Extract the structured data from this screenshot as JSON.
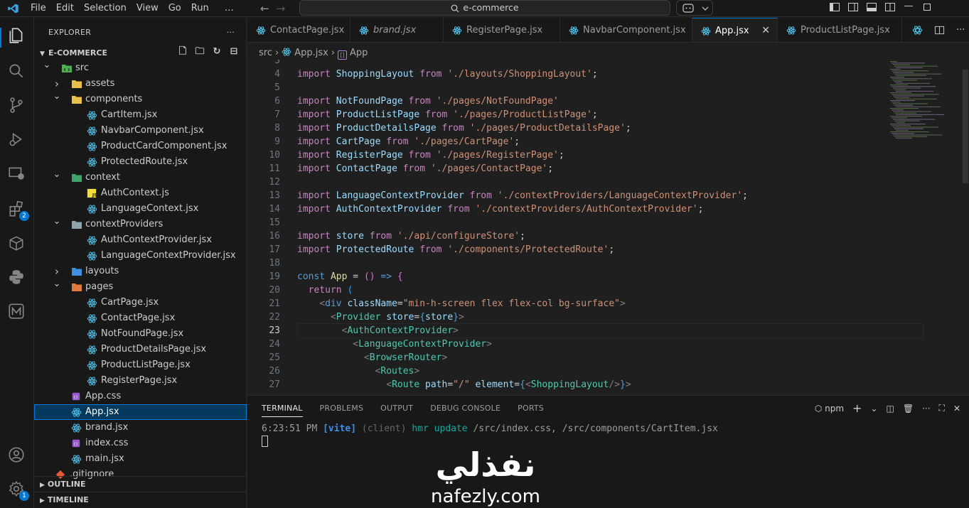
{
  "titlebar": {
    "menu": [
      "File",
      "Edit",
      "Selection",
      "View",
      "Go",
      "Run",
      "…"
    ],
    "search_text": "e-commerce"
  },
  "activity_bar": {
    "icons": [
      "files-icon",
      "search-icon",
      "source-control-icon",
      "run-debug-icon",
      "remote-explorer-icon",
      "extensions-icon",
      "package-icon",
      "python-icon",
      "m-icon",
      "account-icon",
      "settings-icon"
    ],
    "extensions_badge": "2",
    "settings_badge": "1"
  },
  "explorer": {
    "title": "EXPLORER",
    "more": "···",
    "section": "E-COMMERCE",
    "tree": [
      {
        "label": "src",
        "depth": 1,
        "kind": "folder-open",
        "icon": "src"
      },
      {
        "label": "assets",
        "depth": 2,
        "kind": "folder-closed",
        "icon": "folder-yellow"
      },
      {
        "label": "components",
        "depth": 2,
        "kind": "folder-open",
        "icon": "folder-yellow"
      },
      {
        "label": "CartItem.jsx",
        "depth": 3,
        "kind": "file",
        "icon": "react"
      },
      {
        "label": "NavbarComponent.jsx",
        "depth": 3,
        "kind": "file",
        "icon": "react"
      },
      {
        "label": "ProductCardComponent.jsx",
        "depth": 3,
        "kind": "file",
        "icon": "react"
      },
      {
        "label": "ProtectedRoute.jsx",
        "depth": 3,
        "kind": "file",
        "icon": "react"
      },
      {
        "label": "context",
        "depth": 2,
        "kind": "folder-open",
        "icon": "folder-green"
      },
      {
        "label": "AuthContext.js",
        "depth": 3,
        "kind": "file",
        "icon": "js"
      },
      {
        "label": "LanguageContext.jsx",
        "depth": 3,
        "kind": "file",
        "icon": "react"
      },
      {
        "label": "contextProviders",
        "depth": 2,
        "kind": "folder-open",
        "icon": "folder-grey"
      },
      {
        "label": "AuthContextProvider.jsx",
        "depth": 3,
        "kind": "file",
        "icon": "react"
      },
      {
        "label": "LanguageContextProvider.jsx",
        "depth": 3,
        "kind": "file",
        "icon": "react"
      },
      {
        "label": "layouts",
        "depth": 2,
        "kind": "folder-closed",
        "icon": "folder-blue"
      },
      {
        "label": "pages",
        "depth": 2,
        "kind": "folder-open",
        "icon": "folder-orange"
      },
      {
        "label": "CartPage.jsx",
        "depth": 3,
        "kind": "file",
        "icon": "react"
      },
      {
        "label": "ContactPage.jsx",
        "depth": 3,
        "kind": "file",
        "icon": "react"
      },
      {
        "label": "NotFoundPage.jsx",
        "depth": 3,
        "kind": "file",
        "icon": "react"
      },
      {
        "label": "ProductDetailsPage.jsx",
        "depth": 3,
        "kind": "file",
        "icon": "react"
      },
      {
        "label": "ProductListPage.jsx",
        "depth": 3,
        "kind": "file",
        "icon": "react"
      },
      {
        "label": "RegisterPage.jsx",
        "depth": 3,
        "kind": "file",
        "icon": "react"
      },
      {
        "label": "App.css",
        "depth": 2,
        "kind": "file",
        "icon": "css"
      },
      {
        "label": "App.jsx",
        "depth": 2,
        "kind": "file",
        "icon": "react",
        "selected": true
      },
      {
        "label": "brand.jsx",
        "depth": 2,
        "kind": "file",
        "icon": "react"
      },
      {
        "label": "index.css",
        "depth": 2,
        "kind": "file",
        "icon": "css"
      },
      {
        "label": "main.jsx",
        "depth": 2,
        "kind": "file",
        "icon": "react"
      },
      {
        "label": ".gitignore",
        "depth": 1,
        "kind": "file",
        "icon": "git"
      }
    ],
    "outline": "OUTLINE",
    "timeline": "TIMELINE"
  },
  "tabs": [
    {
      "label": "ContactPage.jsx",
      "italic": false,
      "active": false
    },
    {
      "label": "brand.jsx",
      "italic": true,
      "active": false
    },
    {
      "label": "RegisterPage.jsx",
      "italic": false,
      "active": false
    },
    {
      "label": "NavbarComponent.jsx",
      "italic": false,
      "active": false
    },
    {
      "label": "App.jsx",
      "italic": false,
      "active": true
    },
    {
      "label": "ProductListPage.jsx",
      "italic": false,
      "active": false
    }
  ],
  "breadcrumb": {
    "folder": "src",
    "file": "App.jsx",
    "symbol": "App"
  },
  "editor": {
    "current_line": 23,
    "lines": [
      {
        "n": 3,
        "t": []
      },
      {
        "n": 4,
        "t": [
          [
            "k-imp",
            "import "
          ],
          [
            "k-id",
            "ShoppingLayout"
          ],
          [
            "k-imp",
            " from "
          ],
          [
            "k-str",
            "'./layouts/ShoppingLayout'"
          ],
          [
            "k-plain",
            ";"
          ]
        ]
      },
      {
        "n": 5,
        "t": []
      },
      {
        "n": 6,
        "t": [
          [
            "k-imp",
            "import "
          ],
          [
            "k-id",
            "NotFoundPage"
          ],
          [
            "k-imp",
            " from "
          ],
          [
            "k-str",
            "'./pages/NotFoundPage'"
          ]
        ]
      },
      {
        "n": 7,
        "t": [
          [
            "k-imp",
            "import "
          ],
          [
            "k-id",
            "ProductListPage"
          ],
          [
            "k-imp",
            " from "
          ],
          [
            "k-str",
            "'./pages/ProductListPage'"
          ],
          [
            "k-plain",
            ";"
          ]
        ]
      },
      {
        "n": 8,
        "t": [
          [
            "k-imp",
            "import "
          ],
          [
            "k-id",
            "ProductDetailsPage"
          ],
          [
            "k-imp",
            " from "
          ],
          [
            "k-str",
            "'./pages/ProductDetailsPage'"
          ],
          [
            "k-plain",
            ";"
          ]
        ]
      },
      {
        "n": 9,
        "t": [
          [
            "k-imp",
            "import "
          ],
          [
            "k-id",
            "CartPage"
          ],
          [
            "k-imp",
            " from "
          ],
          [
            "k-str",
            "'./pages/CartPage'"
          ],
          [
            "k-plain",
            ";"
          ]
        ]
      },
      {
        "n": 10,
        "t": [
          [
            "k-imp",
            "import "
          ],
          [
            "k-id",
            "RegisterPage"
          ],
          [
            "k-imp",
            " from "
          ],
          [
            "k-str",
            "'./pages/RegisterPage'"
          ],
          [
            "k-plain",
            ";"
          ]
        ]
      },
      {
        "n": 11,
        "t": [
          [
            "k-imp",
            "import "
          ],
          [
            "k-id",
            "ContactPage"
          ],
          [
            "k-imp",
            " from "
          ],
          [
            "k-str",
            "'./pages/ContactPage'"
          ],
          [
            "k-plain",
            ";"
          ]
        ]
      },
      {
        "n": 12,
        "t": []
      },
      {
        "n": 13,
        "t": [
          [
            "k-imp",
            "import "
          ],
          [
            "k-id",
            "LanguageContextProvider"
          ],
          [
            "k-imp",
            " from "
          ],
          [
            "k-str",
            "'./contextProviders/LanguageContextProvider'"
          ],
          [
            "k-plain",
            ";"
          ]
        ]
      },
      {
        "n": 14,
        "t": [
          [
            "k-imp",
            "import "
          ],
          [
            "k-id",
            "AuthContextProvider"
          ],
          [
            "k-imp",
            " from "
          ],
          [
            "k-str",
            "'./contextProviders/AuthContextProvider'"
          ],
          [
            "k-plain",
            ";"
          ]
        ]
      },
      {
        "n": 15,
        "t": []
      },
      {
        "n": 16,
        "t": [
          [
            "k-imp",
            "import "
          ],
          [
            "k-id",
            "store"
          ],
          [
            "k-imp",
            " from "
          ],
          [
            "k-str",
            "'./api/configureStore'"
          ],
          [
            "k-plain",
            ";"
          ]
        ]
      },
      {
        "n": 17,
        "t": [
          [
            "k-imp",
            "import "
          ],
          [
            "k-id",
            "ProtectedRoute"
          ],
          [
            "k-imp",
            " from "
          ],
          [
            "k-str",
            "'./components/ProtectedRoute'"
          ],
          [
            "k-plain",
            ";"
          ]
        ]
      },
      {
        "n": 18,
        "t": []
      },
      {
        "n": 19,
        "t": [
          [
            "k-kw",
            "const "
          ],
          [
            "k-fn",
            "App"
          ],
          [
            "k-plain",
            " = "
          ],
          [
            "k-brk",
            "()"
          ],
          [
            "k-plain",
            " "
          ],
          [
            "k-kw",
            "=>"
          ],
          [
            "k-plain",
            " "
          ],
          [
            "k-brk",
            "{"
          ]
        ]
      },
      {
        "n": 20,
        "t": [
          [
            "k-plain",
            "  "
          ],
          [
            "k-imp",
            "return "
          ],
          [
            "k-brk2",
            "("
          ]
        ]
      },
      {
        "n": 21,
        "t": [
          [
            "k-plain",
            "    "
          ],
          [
            "k-ang",
            "<"
          ],
          [
            "k-kw",
            "div"
          ],
          [
            "k-plain",
            " "
          ],
          [
            "k-attr",
            "className"
          ],
          [
            "k-plain",
            "="
          ],
          [
            "k-str",
            "\"min-h-screen flex flex-col bg-surface\""
          ],
          [
            "k-ang",
            ">"
          ]
        ]
      },
      {
        "n": 22,
        "t": [
          [
            "k-plain",
            "      "
          ],
          [
            "k-ang",
            "<"
          ],
          [
            "k-tag",
            "Provider"
          ],
          [
            "k-plain",
            " "
          ],
          [
            "k-attr",
            "store"
          ],
          [
            "k-plain",
            "="
          ],
          [
            "k-kw",
            "{"
          ],
          [
            "k-id",
            "store"
          ],
          [
            "k-kw",
            "}"
          ],
          [
            "k-ang",
            ">"
          ]
        ]
      },
      {
        "n": 23,
        "t": [
          [
            "k-plain",
            "        "
          ],
          [
            "k-ang",
            "<"
          ],
          [
            "k-tag",
            "AuthContextProvider"
          ],
          [
            "k-ang",
            ">"
          ]
        ]
      },
      {
        "n": 24,
        "t": [
          [
            "k-plain",
            "          "
          ],
          [
            "k-ang",
            "<"
          ],
          [
            "k-tag",
            "LanguageContextProvider"
          ],
          [
            "k-ang",
            ">"
          ]
        ]
      },
      {
        "n": 25,
        "t": [
          [
            "k-plain",
            "            "
          ],
          [
            "k-ang",
            "<"
          ],
          [
            "k-tag",
            "BrowserRouter"
          ],
          [
            "k-ang",
            ">"
          ]
        ]
      },
      {
        "n": 26,
        "t": [
          [
            "k-plain",
            "              "
          ],
          [
            "k-ang",
            "<"
          ],
          [
            "k-tag",
            "Routes"
          ],
          [
            "k-ang",
            ">"
          ]
        ]
      },
      {
        "n": 27,
        "t": [
          [
            "k-plain",
            "                "
          ],
          [
            "k-ang",
            "<"
          ],
          [
            "k-tag",
            "Route"
          ],
          [
            "k-plain",
            " "
          ],
          [
            "k-attr",
            "path"
          ],
          [
            "k-plain",
            "="
          ],
          [
            "k-str",
            "\"/\""
          ],
          [
            "k-plain",
            " "
          ],
          [
            "k-attr",
            "element"
          ],
          [
            "k-plain",
            "="
          ],
          [
            "k-kw",
            "{"
          ],
          [
            "k-ang",
            "<"
          ],
          [
            "k-tag",
            "ShoppingLayout"
          ],
          [
            "k-ang",
            "/>"
          ],
          [
            "k-kw",
            "}"
          ],
          [
            "k-ang",
            ">"
          ]
        ]
      }
    ]
  },
  "panel": {
    "tabs": [
      "TERMINAL",
      "PROBLEMS",
      "OUTPUT",
      "DEBUG CONSOLE",
      "PORTS"
    ],
    "active_tab": "TERMINAL",
    "shell": "npm",
    "terminal": {
      "time": "6:23:51 PM",
      "tag": "[vite]",
      "client": "(client)",
      "msg": "hmr update",
      "paths": "/src/index.css, /src/components/CartItem.jsx"
    }
  },
  "watermark": {
    "arabic": "نفذلي",
    "latin": "nafezly.com"
  },
  "colors": {
    "accent": "#0078d4",
    "react_icon": "#4fc1e9",
    "folder_yellow": "#e8c04a"
  }
}
